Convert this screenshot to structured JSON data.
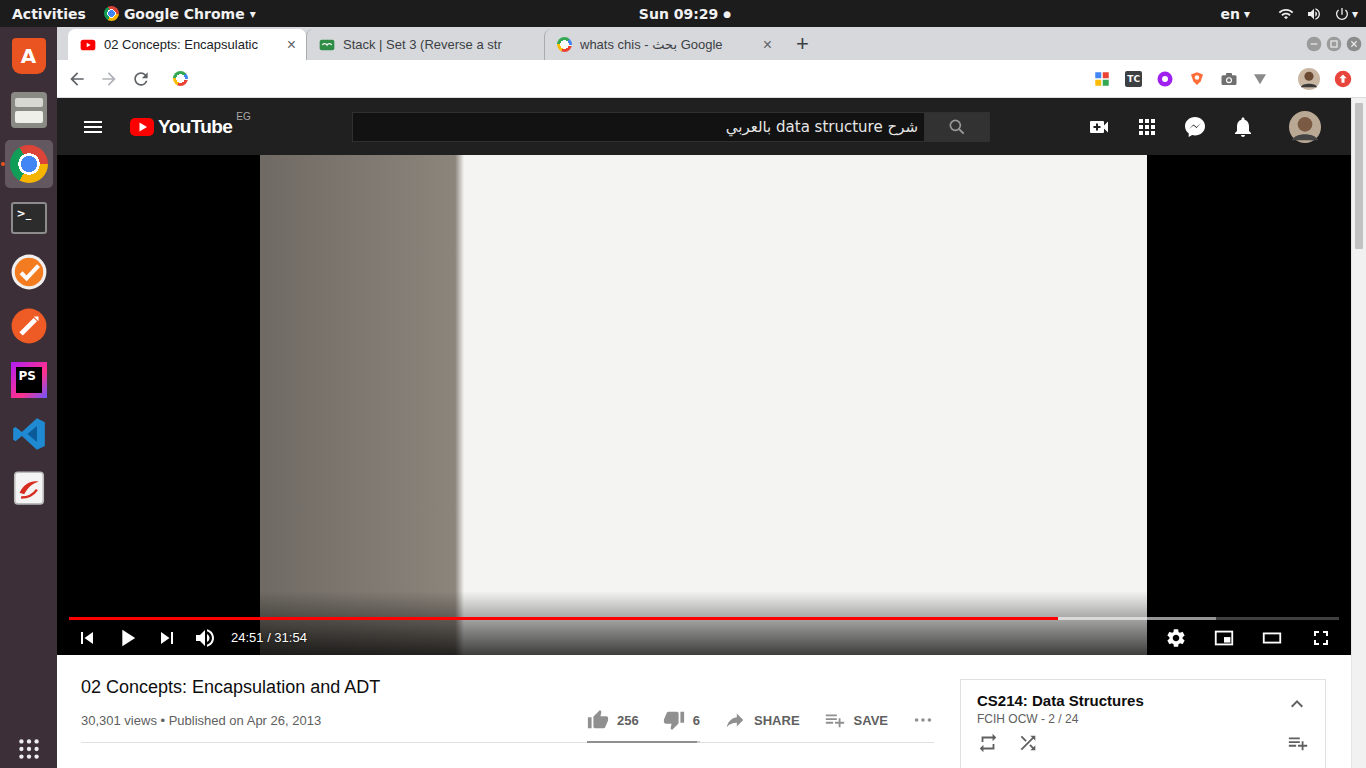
{
  "topbar": {
    "activities": "Activities",
    "app_name": "Google Chrome",
    "app_menu": "▾",
    "clock": "Sun 09:29",
    "clock_dot": "●",
    "input_source": "en",
    "input_menu": "▾",
    "system_menu": "▾"
  },
  "dock": {
    "items": [
      {
        "kind": "software",
        "label": "A",
        "selected": false
      },
      {
        "kind": "files",
        "selected": false
      },
      {
        "kind": "chrome",
        "selected": true
      },
      {
        "kind": "terminal",
        "label": ">_",
        "selected": false
      },
      {
        "kind": "tasks",
        "selected": false
      },
      {
        "kind": "postman",
        "selected": false
      },
      {
        "kind": "phpstorm",
        "label": "PS",
        "selected": false
      },
      {
        "kind": "vscode",
        "selected": false
      },
      {
        "kind": "docviewer",
        "selected": false
      }
    ]
  },
  "browser": {
    "tabs": [
      {
        "kind": "youtube",
        "label": "02 Concepts: Encapsulatic",
        "close": "×",
        "selected": true
      },
      {
        "kind": "gfg",
        "label": "Stack | Set 3 (Reverse a str",
        "selected": false
      },
      {
        "kind": "google",
        "label": "whats chis - بحث Google",
        "close": "×",
        "selected": false
      }
    ],
    "new_tab": "+",
    "extensions": [
      {
        "kind": "grid"
      },
      {
        "kind": "tc",
        "label": "TC"
      },
      {
        "kind": "purple"
      },
      {
        "kind": "orange"
      },
      {
        "kind": "camera"
      },
      {
        "kind": "vee"
      },
      {
        "kind": "avatar"
      },
      {
        "kind": "update"
      }
    ]
  },
  "youtube": {
    "logo": "YouTube",
    "country": "EG",
    "search": "شرح data structure بالعربي"
  },
  "player": {
    "played": 0.779,
    "buffered": 0.903,
    "time": "24:51 / 31:54",
    "playing": false,
    "muted": false
  },
  "video": {
    "title": "02 Concepts: Encapsulation and ADT",
    "meta": "30,301 views • Published on Apr 26, 2013",
    "likes": "256",
    "dislikes": "6",
    "rating": 0.977,
    "share": "SHARE",
    "save": "SAVE"
  },
  "playlist": {
    "title": "CS214: Data Structures",
    "subtitle": "FCIH OCW - 2 / 24",
    "expanded": true
  }
}
